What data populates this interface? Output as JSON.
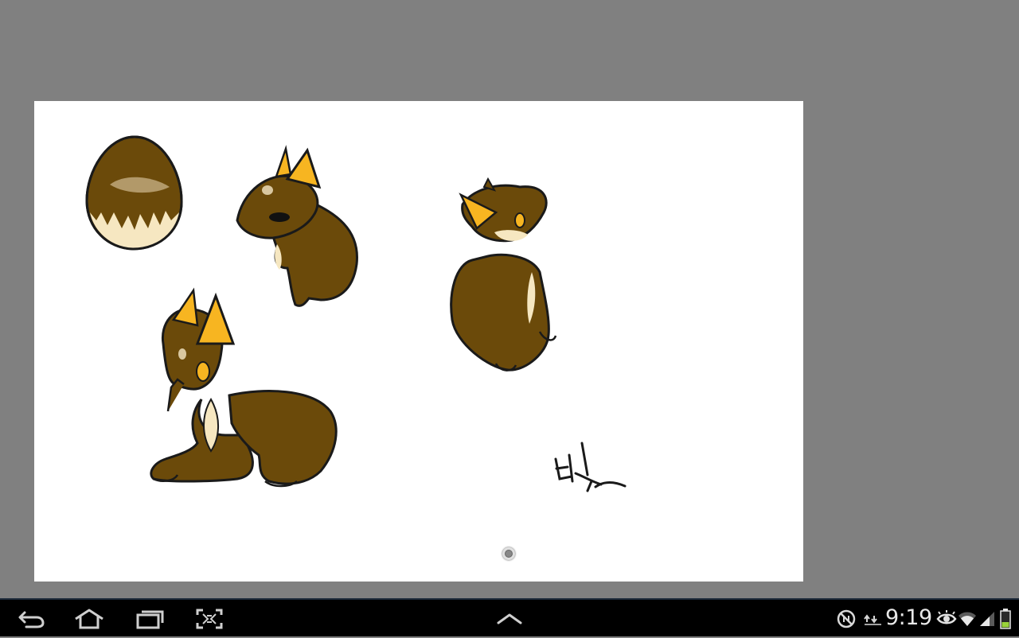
{
  "app": {
    "canvas_background": "#ffffff",
    "workspace_background": "#808080",
    "artwork": {
      "subjects": [
        "egg",
        "standing-pup",
        "sitting-pup-back",
        "lying-pup"
      ],
      "signature": "빈츠",
      "colors": {
        "fur": "#6b4a0a",
        "ear_inner": "#f7b521",
        "chest": "#f6e7c1",
        "outline": "#1a1a1a"
      }
    },
    "scroll_handle": "radio-dot-icon"
  },
  "system_bar": {
    "background": "#000000",
    "nav_buttons": [
      "back-icon",
      "home-icon",
      "recent-apps-icon",
      "screenshot-icon"
    ],
    "center_button": "menu-up-icon",
    "status_icons": [
      "no-sync-icon",
      "data-transfer-icon",
      "eye-icon",
      "wifi-icon",
      "signal-icon",
      "battery-icon"
    ],
    "time": "9:19",
    "battery_color": "#9ad33a"
  }
}
